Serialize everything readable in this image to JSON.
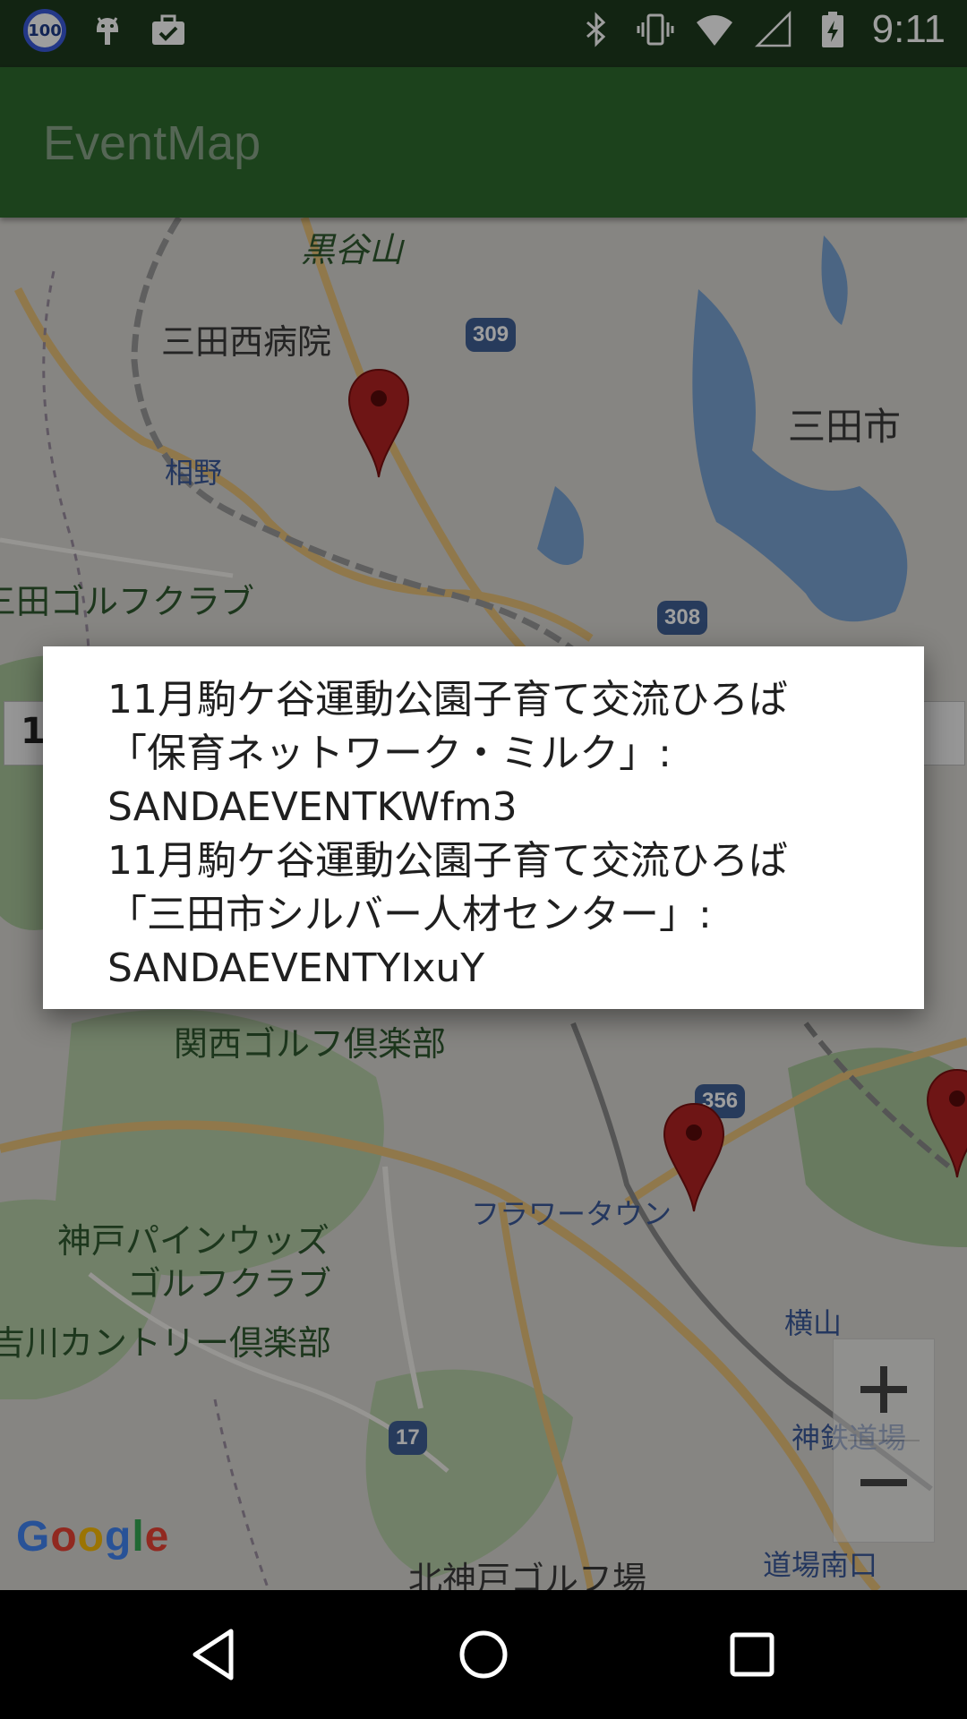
{
  "status_bar": {
    "battery_badge": "100",
    "time": "9:11",
    "icons": [
      "battery-100-badge-icon",
      "android-icon",
      "briefcase-check-icon",
      "bluetooth-icon",
      "vibrate-icon",
      "wifi-icon",
      "cellular-signal-icon",
      "battery-charging-icon"
    ]
  },
  "app_bar": {
    "title": "EventMap"
  },
  "map": {
    "labels": {
      "kurotaniyama": "黒谷山",
      "sanda_nishi_hospital": "三田西病院",
      "sanda_city": "三田市",
      "aino": "相野",
      "sanda_golf": "三田ゴルフクラブ",
      "kansai_golf": "関西ゴルフ倶楽部",
      "flower_town": "フラワータウン",
      "kobe_pine_woods_1": "神戸パインウッズ",
      "kobe_pine_woods_2": "ゴルフクラブ",
      "yokawa_country": "吉川カントリー倶楽部",
      "yokoyama": "横山",
      "shintetsu_dojo": "神鉄道場",
      "kita_kobe_golf": "北神戸ゴルフ場",
      "dojo_minamiguchi": "道場南口"
    },
    "road_numbers": [
      "309",
      "308",
      "356",
      "17"
    ],
    "zoom_in_symbol": "+",
    "zoom_out_symbol": "−",
    "google_logo": "Google",
    "partial_left": "1"
  },
  "dialog": {
    "items": [
      "11月駒ケ谷運動公園子育て交流ひろば\n「保育ネットワーク・ミルク」:\nSANDAEVENTKWfm3",
      "11月駒ケ谷運動公園子育て交流ひろば\n「三田市シルバー人材センター」:\nSANDAEVENTYIxuY"
    ]
  },
  "colors": {
    "status_bar": "#1e3a1e",
    "app_bar": "#2e6b2e",
    "marker": "#b22222"
  }
}
